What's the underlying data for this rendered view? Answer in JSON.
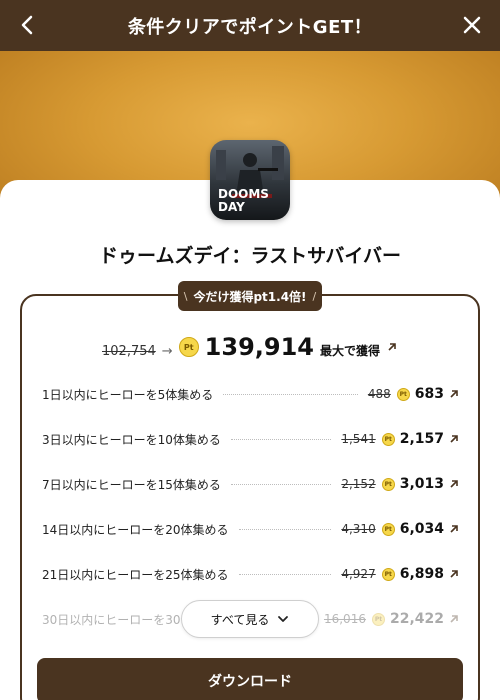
{
  "header": {
    "title": "条件クリアでポイントGET！"
  },
  "app": {
    "name": "ドゥームズデイ：ラストサバイバー",
    "icon_text_line1": "DOOMS",
    "icon_text_line2": "DAY"
  },
  "badge": {
    "left_mark": "\\",
    "text": "今だけ獲得pt1.4倍!",
    "right_mark": "/"
  },
  "total": {
    "old": "102,754",
    "arrow": "→",
    "new": "139,914",
    "suffix": "最大で獲得"
  },
  "pt_label": "Pt",
  "tasks": [
    {
      "label": "1日以内にヒーローを5体集める",
      "old": "488",
      "points": "683"
    },
    {
      "label": "3日以内にヒーローを10体集める",
      "old": "1,541",
      "points": "2,157"
    },
    {
      "label": "7日以内にヒーローを15体集める",
      "old": "2,152",
      "points": "3,013"
    },
    {
      "label": "14日以内にヒーローを20体集める",
      "old": "4,310",
      "points": "6,034"
    },
    {
      "label": "21日以内にヒーローを25体集める",
      "old": "4,927",
      "points": "6,898"
    },
    {
      "label": "30日以内にヒーローを30体集める",
      "old": "16,016",
      "points": "22,422"
    }
  ],
  "see_all_label": "すべて見る",
  "download_label": "ダウンロード",
  "colors": {
    "brand_brown": "#4a3420",
    "hero_gold": "#e0a53d",
    "coin": "#f6d74a"
  },
  "icons": [
    "back-arrow-icon",
    "close-icon",
    "pt-coin-icon",
    "external-link-icon",
    "chevron-down-icon"
  ]
}
